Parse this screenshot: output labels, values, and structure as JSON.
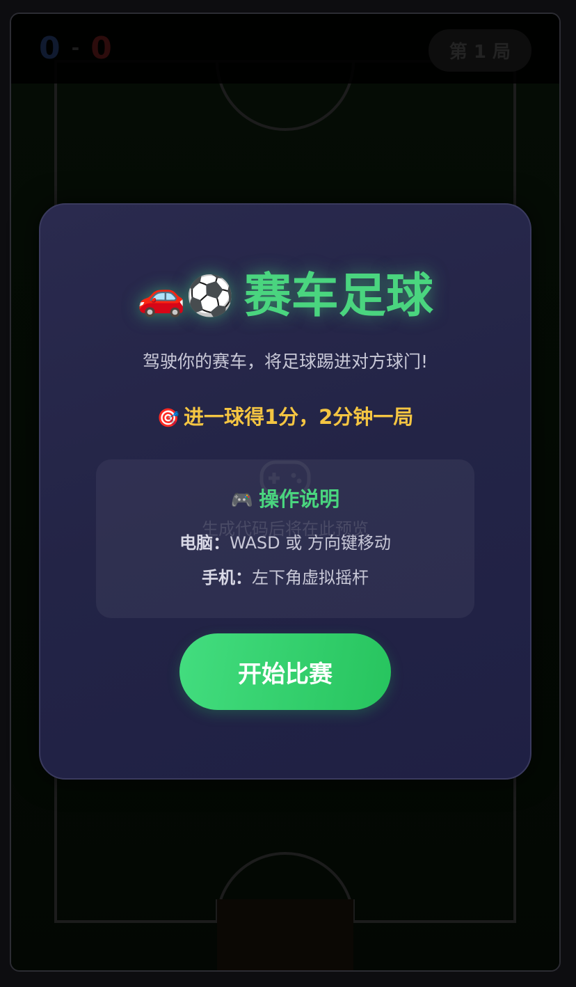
{
  "scoreboard": {
    "blue_score": "0",
    "separator": "-",
    "red_score": "0",
    "round_label": "第 1 局"
  },
  "modal": {
    "title_emoji": "🚗⚽",
    "title": "赛车足球",
    "subtitle": "驾驶你的赛车，将足球踢进对方球门!",
    "rule_emoji": "🎯",
    "rule": "进一球得1分，2分钟一局",
    "controls": {
      "title_emoji": "🎮",
      "title": "操作说明",
      "preview_placeholder": "生成代码后将在此预览",
      "pc_label": "电脑：",
      "pc_text": "WASD 或 方向键移动",
      "mobile_label": "手机：",
      "mobile_text": "左下角虚拟摇杆"
    },
    "start_button": "开始比赛"
  },
  "colors": {
    "accent_green": "#4ad57f",
    "rule_yellow": "#f4c542",
    "modal_bg": "#232446",
    "blue_team": "#16233f",
    "red_team": "#3b1010"
  },
  "icons": {
    "title": "car-ball-emoji",
    "rule": "dart-target-emoji",
    "controls": "gamepad-emoji",
    "preview": "gamepad-outline-icon"
  }
}
